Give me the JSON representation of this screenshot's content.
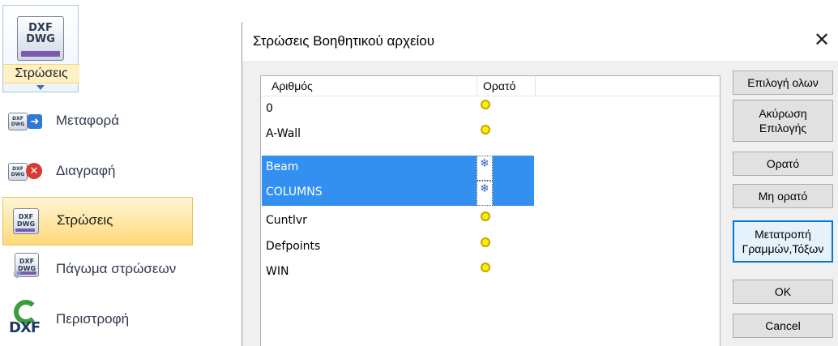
{
  "ribbon": {
    "icon_line1": "DXF",
    "icon_line2": "DWG",
    "label": "Στρώσεις"
  },
  "menu": {
    "items": [
      {
        "label": "Μεταφορά",
        "icon": "dxf-transfer-icon"
      },
      {
        "label": "Διαγραφή",
        "icon": "dxf-delete-icon"
      },
      {
        "label": "Στρώσεις",
        "icon": "dxf-layers-icon",
        "selected": true
      },
      {
        "label": "Πάγωμα στρώσεων",
        "icon": "dxf-freeze-icon"
      },
      {
        "label": "Περιστροφή",
        "icon": "dxf-rotate-icon"
      }
    ]
  },
  "dialog": {
    "title": "Στρώσεις Βοηθητικού αρχείου",
    "close": "✕",
    "columns": [
      "Αριθμός",
      "Ορατό"
    ],
    "rows": [
      {
        "name": "0",
        "visible": true,
        "selected": false
      },
      {
        "name": "A-Wall",
        "visible": true,
        "selected": false
      },
      {
        "name": "Beam",
        "visible": false,
        "selected": true
      },
      {
        "name": "COLUMNS",
        "visible": false,
        "selected": true
      },
      {
        "name": "Cuntlvr",
        "visible": true,
        "selected": false
      },
      {
        "name": "Defpoints",
        "visible": true,
        "selected": false
      },
      {
        "name": "WIN",
        "visible": true,
        "selected": false
      }
    ],
    "buttons": {
      "select_all": "Επιλογή ολων",
      "cancel_selection_1": "Ακύρωση",
      "cancel_selection_2": "Επιλογής",
      "visible": "Ορατό",
      "not_visible": "Μη ορατό",
      "convert_1": "Μετατροπή",
      "convert_2": "Γραμμών,Τόξων",
      "ok": "OK",
      "cancel": "Cancel"
    }
  },
  "colors": {
    "selection": "#3390f0",
    "menu_highlight": "#ffd978",
    "focus_border": "#0078d7"
  }
}
